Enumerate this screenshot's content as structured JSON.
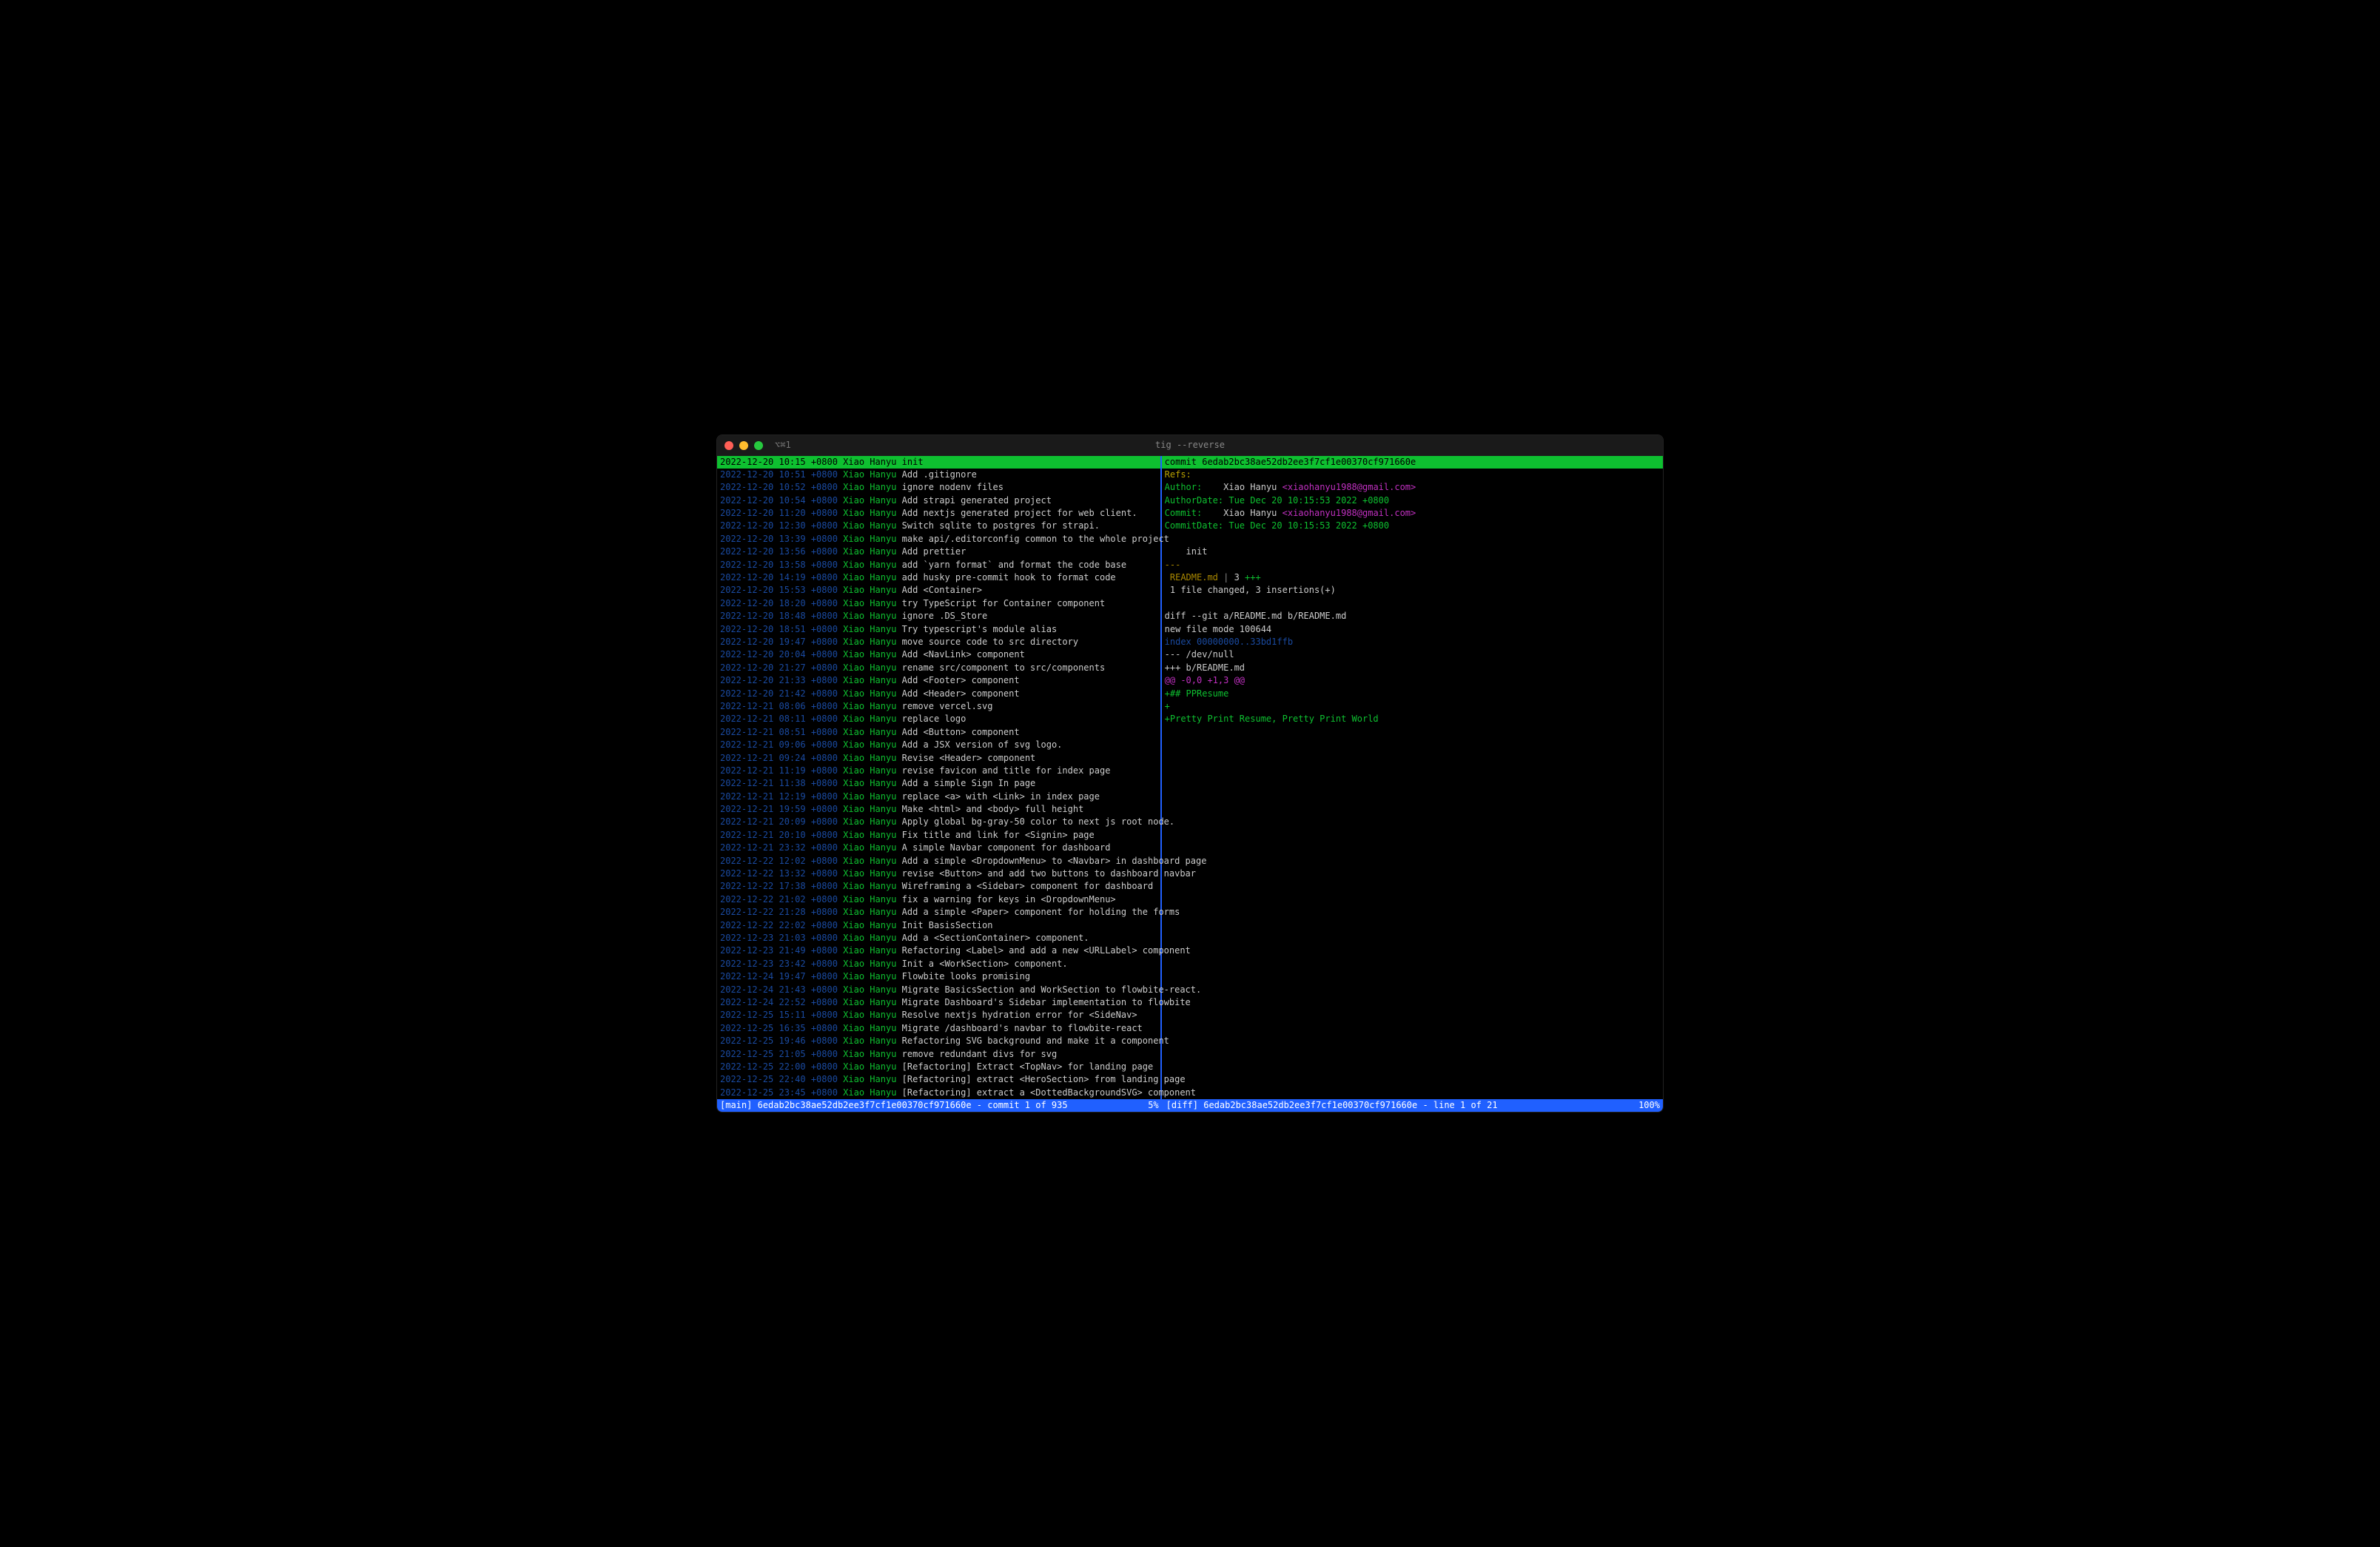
{
  "window": {
    "tab_hint": "⌥⌘1",
    "title": "tig --reverse"
  },
  "commits": [
    {
      "date": "2022-12-20 10:15 +0800",
      "author": "Xiao Hanyu",
      "msg": "init",
      "selected": true
    },
    {
      "date": "2022-12-20 10:51 +0800",
      "author": "Xiao Hanyu",
      "msg": "Add .gitignore"
    },
    {
      "date": "2022-12-20 10:52 +0800",
      "author": "Xiao Hanyu",
      "msg": "ignore nodenv files"
    },
    {
      "date": "2022-12-20 10:54 +0800",
      "author": "Xiao Hanyu",
      "msg": "Add strapi generated project"
    },
    {
      "date": "2022-12-20 11:20 +0800",
      "author": "Xiao Hanyu",
      "msg": "Add nextjs generated project for web client."
    },
    {
      "date": "2022-12-20 12:30 +0800",
      "author": "Xiao Hanyu",
      "msg": "Switch sqlite to postgres for strapi."
    },
    {
      "date": "2022-12-20 13:39 +0800",
      "author": "Xiao Hanyu",
      "msg": "make api/.editorconfig common to the whole project"
    },
    {
      "date": "2022-12-20 13:56 +0800",
      "author": "Xiao Hanyu",
      "msg": "Add prettier"
    },
    {
      "date": "2022-12-20 13:58 +0800",
      "author": "Xiao Hanyu",
      "msg": "add `yarn format` and format the code base"
    },
    {
      "date": "2022-12-20 14:19 +0800",
      "author": "Xiao Hanyu",
      "msg": "add husky pre-commit hook to format code"
    },
    {
      "date": "2022-12-20 15:53 +0800",
      "author": "Xiao Hanyu",
      "msg": "Add <Container>"
    },
    {
      "date": "2022-12-20 18:20 +0800",
      "author": "Xiao Hanyu",
      "msg": "try TypeScript for Container component"
    },
    {
      "date": "2022-12-20 18:48 +0800",
      "author": "Xiao Hanyu",
      "msg": "ignore .DS_Store"
    },
    {
      "date": "2022-12-20 18:51 +0800",
      "author": "Xiao Hanyu",
      "msg": "Try typescript's module alias"
    },
    {
      "date": "2022-12-20 19:47 +0800",
      "author": "Xiao Hanyu",
      "msg": "move source code to src directory"
    },
    {
      "date": "2022-12-20 20:04 +0800",
      "author": "Xiao Hanyu",
      "msg": "Add <NavLink> component"
    },
    {
      "date": "2022-12-20 21:27 +0800",
      "author": "Xiao Hanyu",
      "msg": "rename src/component to src/components"
    },
    {
      "date": "2022-12-20 21:33 +0800",
      "author": "Xiao Hanyu",
      "msg": "Add <Footer> component"
    },
    {
      "date": "2022-12-20 21:42 +0800",
      "author": "Xiao Hanyu",
      "msg": "Add <Header> component"
    },
    {
      "date": "2022-12-21 08:06 +0800",
      "author": "Xiao Hanyu",
      "msg": "remove vercel.svg"
    },
    {
      "date": "2022-12-21 08:11 +0800",
      "author": "Xiao Hanyu",
      "msg": "replace logo"
    },
    {
      "date": "2022-12-21 08:51 +0800",
      "author": "Xiao Hanyu",
      "msg": "Add <Button> component"
    },
    {
      "date": "2022-12-21 09:06 +0800",
      "author": "Xiao Hanyu",
      "msg": "Add a JSX version of svg logo."
    },
    {
      "date": "2022-12-21 09:24 +0800",
      "author": "Xiao Hanyu",
      "msg": "Revise <Header> component"
    },
    {
      "date": "2022-12-21 11:19 +0800",
      "author": "Xiao Hanyu",
      "msg": "revise favicon and title for index page"
    },
    {
      "date": "2022-12-21 11:38 +0800",
      "author": "Xiao Hanyu",
      "msg": "Add a simple Sign In page"
    },
    {
      "date": "2022-12-21 12:19 +0800",
      "author": "Xiao Hanyu",
      "msg": "replace <a> with <Link> in index page"
    },
    {
      "date": "2022-12-21 19:59 +0800",
      "author": "Xiao Hanyu",
      "msg": "Make <html> and <body> full height"
    },
    {
      "date": "2022-12-21 20:09 +0800",
      "author": "Xiao Hanyu",
      "msg": "Apply global bg-gray-50 color to next js root node."
    },
    {
      "date": "2022-12-21 20:10 +0800",
      "author": "Xiao Hanyu",
      "msg": "Fix title and link for <Signin> page"
    },
    {
      "date": "2022-12-21 23:32 +0800",
      "author": "Xiao Hanyu",
      "msg": "A simple Navbar component for dashboard"
    },
    {
      "date": "2022-12-22 12:02 +0800",
      "author": "Xiao Hanyu",
      "msg": "Add a simple <DropdownMenu> to <Navbar> in dashboard page"
    },
    {
      "date": "2022-12-22 13:32 +0800",
      "author": "Xiao Hanyu",
      "msg": "revise <Button> and add two buttons to dashboard navbar"
    },
    {
      "date": "2022-12-22 17:38 +0800",
      "author": "Xiao Hanyu",
      "msg": "Wireframing a <Sidebar> component for dashboard"
    },
    {
      "date": "2022-12-22 21:02 +0800",
      "author": "Xiao Hanyu",
      "msg": "fix a warning for keys in <DropdownMenu>"
    },
    {
      "date": "2022-12-22 21:28 +0800",
      "author": "Xiao Hanyu",
      "msg": "Add a simple <Paper> component for holding the forms"
    },
    {
      "date": "2022-12-22 22:02 +0800",
      "author": "Xiao Hanyu",
      "msg": "Init BasisSection"
    },
    {
      "date": "2022-12-23 21:03 +0800",
      "author": "Xiao Hanyu",
      "msg": "Add a <SectionContainer> component."
    },
    {
      "date": "2022-12-23 21:49 +0800",
      "author": "Xiao Hanyu",
      "msg": "Refactoring <Label> and add a new <URLLabel> component"
    },
    {
      "date": "2022-12-23 23:42 +0800",
      "author": "Xiao Hanyu",
      "msg": "Init a <WorkSection> component."
    },
    {
      "date": "2022-12-24 19:47 +0800",
      "author": "Xiao Hanyu",
      "msg": "Flowbite looks promising"
    },
    {
      "date": "2022-12-24 21:43 +0800",
      "author": "Xiao Hanyu",
      "msg": "Migrate BasicsSection and WorkSection to flowbite-react."
    },
    {
      "date": "2022-12-24 22:52 +0800",
      "author": "Xiao Hanyu",
      "msg": "Migrate Dashboard's Sidebar implementation to flowbite"
    },
    {
      "date": "2022-12-25 15:11 +0800",
      "author": "Xiao Hanyu",
      "msg": "Resolve nextjs hydration error for <SideNav>"
    },
    {
      "date": "2022-12-25 16:35 +0800",
      "author": "Xiao Hanyu",
      "msg": "Migrate /dashboard's navbar to flowbite-react"
    },
    {
      "date": "2022-12-25 19:46 +0800",
      "author": "Xiao Hanyu",
      "msg": "Refactoring SVG background and make it a component"
    },
    {
      "date": "2022-12-25 21:05 +0800",
      "author": "Xiao Hanyu",
      "msg": "remove redundant divs for svg"
    },
    {
      "date": "2022-12-25 22:00 +0800",
      "author": "Xiao Hanyu",
      "msg": "[Refactoring] Extract <TopNav> for landing page"
    },
    {
      "date": "2022-12-25 22:40 +0800",
      "author": "Xiao Hanyu",
      "msg": "[Refactoring] extract <HeroSection> from landing page"
    },
    {
      "date": "2022-12-25 23:45 +0800",
      "author": "Xiao Hanyu",
      "msg": "[Refactoring] extract a <DottedBackgroundSVG> component"
    }
  ],
  "diff": {
    "header": "commit 6edab2bc38ae52db2ee3f7cf1e00370cf971660e",
    "refs": "Refs:",
    "author_label": "Author:    ",
    "author_name": "Xiao Hanyu ",
    "author_email": "<xiaohanyu1988@gmail.com>",
    "authordate": "AuthorDate: Tue Dec 20 10:15:53 2022 +0800",
    "commit_label": "Commit:    ",
    "commit_name": "Xiao Hanyu ",
    "commit_email": "<xiaohanyu1988@gmail.com>",
    "commitdate": "CommitDate: Tue Dec 20 10:15:53 2022 +0800",
    "subject": "    init",
    "dashes": "---",
    "filestat_name": " README.md",
    "filestat_sep": " | ",
    "filestat_num": "3 ",
    "filestat_plus": "+++",
    "summary": " 1 file changed, 3 insertions(+)",
    "diffcmd": "diff --git a/README.md b/README.md",
    "newfile": "new file mode 100644",
    "index": "index 00000000..33bd1ffb",
    "minus": "--- /dev/null",
    "plus": "+++ b/README.md",
    "hunk": "@@ -0,0 +1,3 @@",
    "add1": "+## PPResume",
    "add2": "+",
    "add3": "+Pretty Print Resume, Pretty Print World"
  },
  "status": {
    "left_text": "[main] 6edab2bc38ae52db2ee3f7cf1e00370cf971660e - commit 1 of 935",
    "left_pct": "5%",
    "right_text": "[diff] 6edab2bc38ae52db2ee3f7cf1e00370cf971660e - line 1 of 21",
    "right_pct": "100%"
  }
}
